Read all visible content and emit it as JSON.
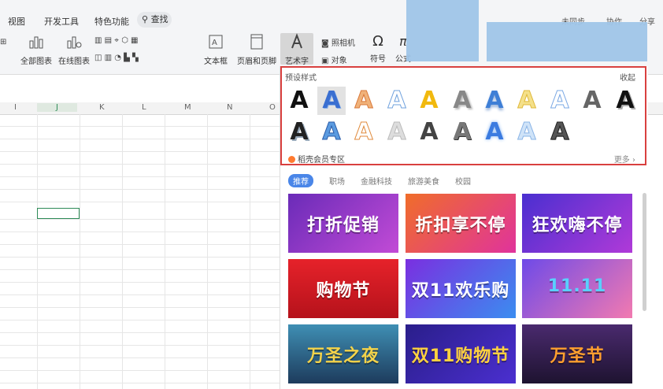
{
  "menubar": {
    "tabs": [
      "视图",
      "开发工具",
      "特色功能"
    ],
    "search_label": "查找",
    "right_items": [
      "未同步",
      "协作",
      "分享"
    ]
  },
  "ribbon": {
    "buttons": [
      "全部图表",
      "在线图表",
      "文本框",
      "页眉和页脚",
      "艺术字",
      "符号",
      "公式"
    ],
    "small_buttons": [
      "照相机",
      "对象"
    ]
  },
  "sheet": {
    "columns": [
      "I",
      "J",
      "K",
      "L",
      "M",
      "N",
      "O"
    ]
  },
  "preset": {
    "title": "预设样式",
    "collapse_label": "收起",
    "glyph": "A",
    "member_label": "稻壳会员专区",
    "more_label": "更多"
  },
  "categories": [
    "推荐",
    "职场",
    "金融科技",
    "旅游美食",
    "校园"
  ],
  "templates": [
    {
      "label": "打折促销"
    },
    {
      "label": "折扣享不停"
    },
    {
      "label": "狂欢嗨不停"
    },
    {
      "label": "购物节"
    },
    {
      "label": "双11欢乐购"
    },
    {
      "label": "11.11"
    },
    {
      "label": "万圣之夜"
    },
    {
      "label": "双11购物节"
    },
    {
      "label": "万圣节"
    }
  ],
  "colors": {
    "highlight_border": "#d9403f",
    "accent": "#4a86e8",
    "member_icon": "#ff7a2f"
  }
}
